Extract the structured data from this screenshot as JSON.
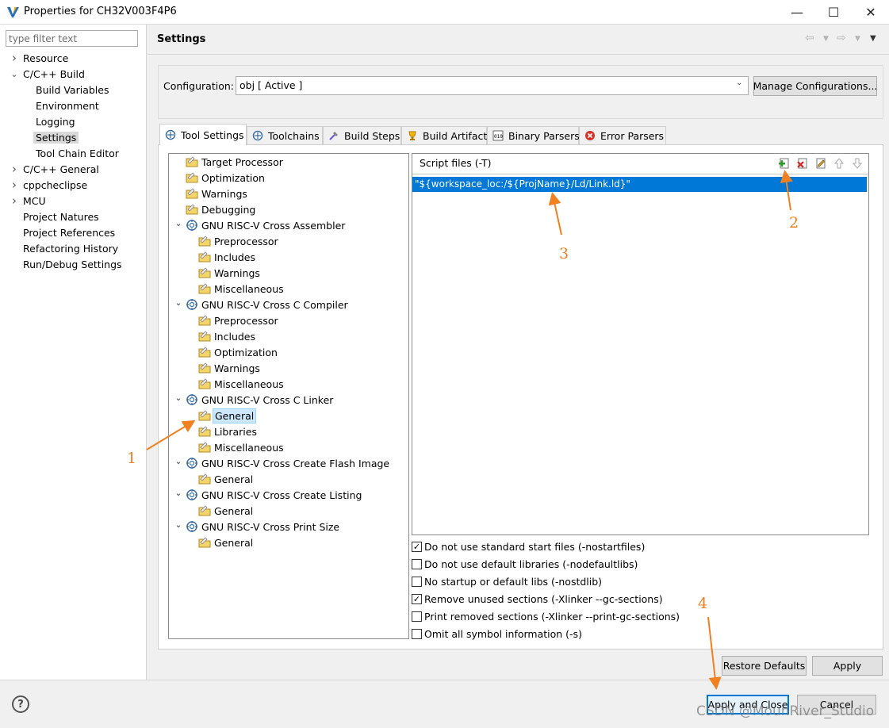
{
  "window": {
    "title": "Properties for CH32V003F4P6",
    "controls": {
      "minimize": "—",
      "maximize": "☐",
      "close": "✕"
    }
  },
  "filter": {
    "placeholder": "type filter text",
    "value": ""
  },
  "nav": {
    "items": [
      {
        "label": "Resource",
        "arrow": "›"
      },
      {
        "label": "C/C++ Build",
        "arrow": "⌄"
      },
      {
        "label": "Build Variables"
      },
      {
        "label": "Environment"
      },
      {
        "label": "Logging"
      },
      {
        "label": "Settings",
        "selected": true
      },
      {
        "label": "Tool Chain Editor"
      },
      {
        "label": "C/C++ General",
        "arrow": "›"
      },
      {
        "label": "cppcheclipse",
        "arrow": "›"
      },
      {
        "label": "MCU",
        "arrow": "›"
      },
      {
        "label": "Project Natures"
      },
      {
        "label": "Project References"
      },
      {
        "label": "Refactoring History"
      },
      {
        "label": "Run/Debug Settings"
      }
    ]
  },
  "header": {
    "title": "Settings"
  },
  "configuration": {
    "label": "Configuration:",
    "value": "obj  [ Active ]",
    "manage_button": "Manage Configurations..."
  },
  "tabs": [
    {
      "label": "Tool Settings",
      "active": true,
      "icon": "tool-settings-icon"
    },
    {
      "label": "Toolchains",
      "icon": "toolchains-icon"
    },
    {
      "label": "Build Steps",
      "icon": "build-steps-icon"
    },
    {
      "label": "Build Artifact",
      "icon": "trophy-icon"
    },
    {
      "label": "Binary Parsers",
      "icon": "binary-icon"
    },
    {
      "label": "Error Parsers",
      "icon": "error-icon"
    }
  ],
  "tool_tree": [
    {
      "label": "Target Processor"
    },
    {
      "label": "Optimization"
    },
    {
      "label": "Warnings"
    },
    {
      "label": "Debugging"
    },
    {
      "label": "GNU RISC-V Cross Assembler",
      "group": true
    },
    {
      "label": "Preprocessor"
    },
    {
      "label": "Includes"
    },
    {
      "label": "Warnings"
    },
    {
      "label": "Miscellaneous"
    },
    {
      "label": "GNU RISC-V Cross C Compiler",
      "group": true
    },
    {
      "label": "Preprocessor"
    },
    {
      "label": "Includes"
    },
    {
      "label": "Optimization"
    },
    {
      "label": "Warnings"
    },
    {
      "label": "Miscellaneous"
    },
    {
      "label": "GNU RISC-V Cross C Linker",
      "group": true
    },
    {
      "label": "General",
      "selected": true
    },
    {
      "label": "Libraries"
    },
    {
      "label": "Miscellaneous"
    },
    {
      "label": "GNU RISC-V Cross Create Flash Image",
      "group": true
    },
    {
      "label": "General"
    },
    {
      "label": "GNU RISC-V Cross Create Listing",
      "group": true
    },
    {
      "label": "General"
    },
    {
      "label": "GNU RISC-V Cross Print Size",
      "group": true
    },
    {
      "label": "General"
    }
  ],
  "script_files": {
    "title": "Script files (-T)",
    "entries": [
      "\"${workspace_loc:/${ProjName}/Ld/Link.ld}\""
    ]
  },
  "options": [
    {
      "label": "Do not use standard start files (-nostartfiles)",
      "checked": true
    },
    {
      "label": "Do not use default libraries (-nodefaultlibs)",
      "checked": false
    },
    {
      "label": "No startup or default libs (-nostdlib)",
      "checked": false
    },
    {
      "label": "Remove unused sections (-Xlinker --gc-sections)",
      "checked": true
    },
    {
      "label": "Print removed sections (-Xlinker --print-gc-sections)",
      "checked": false
    },
    {
      "label": "Omit all symbol information (-s)",
      "checked": false
    }
  ],
  "buttons": {
    "restore_defaults": "Restore Defaults",
    "apply": "Apply",
    "apply_and_close": "Apply and Close",
    "cancel": "Cancel",
    "help": "?"
  },
  "annotations": {
    "n1": "1",
    "n2": "2",
    "n3": "3",
    "n4": "4",
    "color": "#f08020"
  },
  "watermark": "CSDN @MounRiver_Studio",
  "colors": {
    "selection": "#0078d7",
    "tree_selection": "#cce8ff",
    "nav_selection": "#d9d9d9"
  }
}
